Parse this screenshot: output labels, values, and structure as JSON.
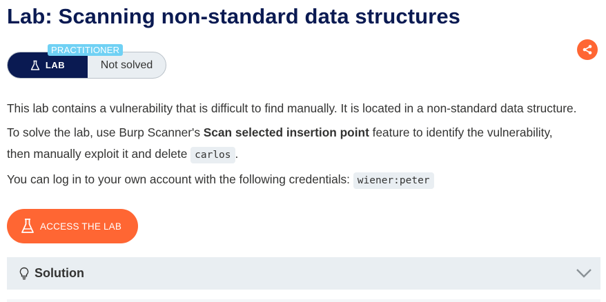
{
  "page": {
    "title": "Lab: Scanning non-standard data structures"
  },
  "share": {
    "icon": "share-icon",
    "color": "#ff6633"
  },
  "lab_badge": {
    "level": "PRACTITIONER",
    "type_label": "LAB",
    "status": "Not solved",
    "icon": "flask-icon",
    "level_color": "#70d1f4",
    "type_color": "#0a1a52"
  },
  "description": {
    "line1": "This lab contains a vulnerability that is difficult to find manually. It is located in a non-standard data structure.",
    "line2_prefix": "To solve the lab, use Burp Scanner's ",
    "line2_bold": "Scan selected insertion point",
    "line2_suffix": " feature to identify the vulnerability,",
    "line3_prefix": "then manually exploit it and delete ",
    "line3_code": "carlos",
    "line3_suffix": ".",
    "line4_prefix": "You can log in to your own account with the following credentials: ",
    "line4_code": "wiener:peter"
  },
  "access_button": {
    "label": "ACCESS THE LAB",
    "icon": "flask-icon",
    "color": "#ff6633"
  },
  "solution": {
    "label": "Solution",
    "icon": "lightbulb-icon",
    "chevron": "chevron-down-icon",
    "expanded": false
  }
}
